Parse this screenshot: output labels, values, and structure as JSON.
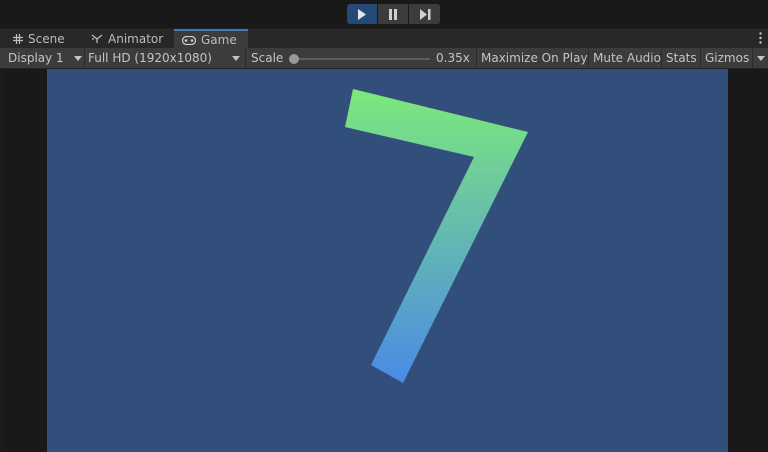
{
  "playbar": {
    "play_icon": "play-icon",
    "pause_icon": "pause-icon",
    "step_icon": "step-forward-icon"
  },
  "tabs": [
    {
      "label": "Scene",
      "icon": "grid-icon"
    },
    {
      "label": "Animator",
      "icon": "animator-icon"
    },
    {
      "label": "Game",
      "icon": "gamepad-icon",
      "active": true
    }
  ],
  "toolbar": {
    "display": "Display 1",
    "resolution": "Full HD (1920x1080)",
    "scale_label": "Scale",
    "scale_value": "0.35x",
    "scale_fraction": 0.0,
    "maximize": "Maximize On Play",
    "mute": "Mute Audio",
    "stats": "Stats",
    "gizmos": "Gizmos"
  },
  "game": {
    "background_color": "#314f7a",
    "shape_gradient": [
      "#7de87c",
      "#4a8ae6"
    ]
  }
}
